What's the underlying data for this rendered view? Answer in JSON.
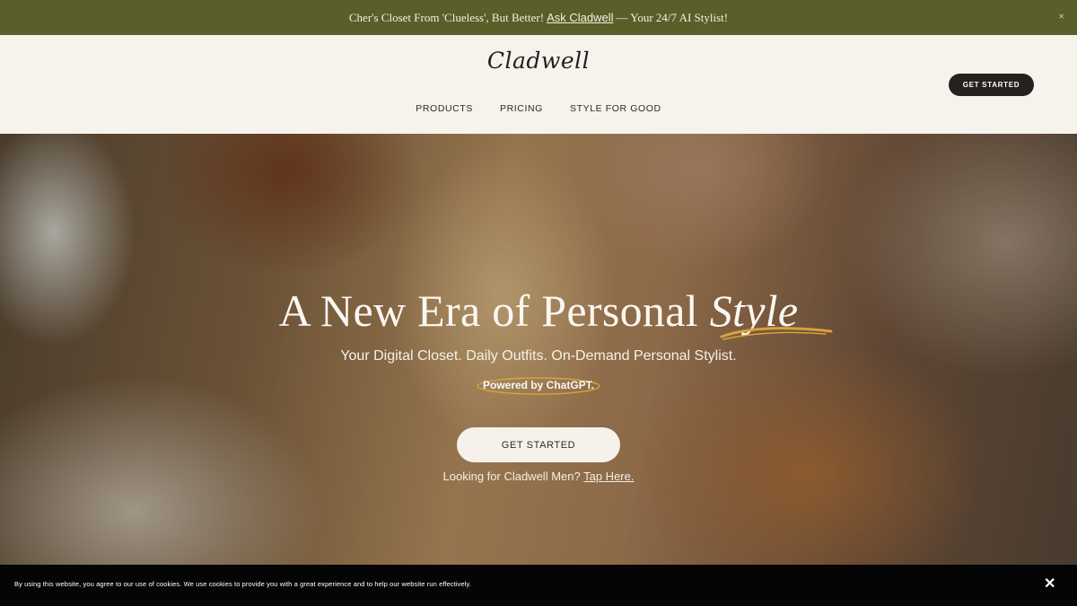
{
  "announcement": {
    "text_before": "Cher's Closet From 'Clueless', But Better!",
    "link_label": "Ask Cladwell",
    "text_after": "— Your 24/7 AI Stylist!",
    "close_icon": "×"
  },
  "header": {
    "logo": "Cladwell",
    "nav": [
      "PRODUCTS",
      "PRICING",
      "STYLE FOR GOOD"
    ],
    "cta_label": "GET STARTED"
  },
  "hero": {
    "title_main": "A New Era of Personal ",
    "title_accent": "Style",
    "subtitle": "Your Digital Closet. Daily Outfits. On-Demand Personal Stylist.",
    "powered_by": "Powered by ChatGPT.",
    "cta_label": "GET STARTED",
    "men_text": "Looking for Cladwell Men?",
    "men_link": "Tap Here."
  },
  "cookie_bar": {
    "message": "By using this website, you agree to our use of cookies. We use cookies to provide you with a great experience and to help our website run effectively.",
    "close_icon": "✕"
  },
  "colors": {
    "announcement_bg": "#5a5e28",
    "header_bg": "#f6f2ec",
    "dark_button": "#26211f",
    "accent_gold": "#d9a33a",
    "cookie_bg": "#050505"
  },
  "icons": {
    "announcement_close": "close-icon",
    "cookie_close": "close-icon"
  }
}
